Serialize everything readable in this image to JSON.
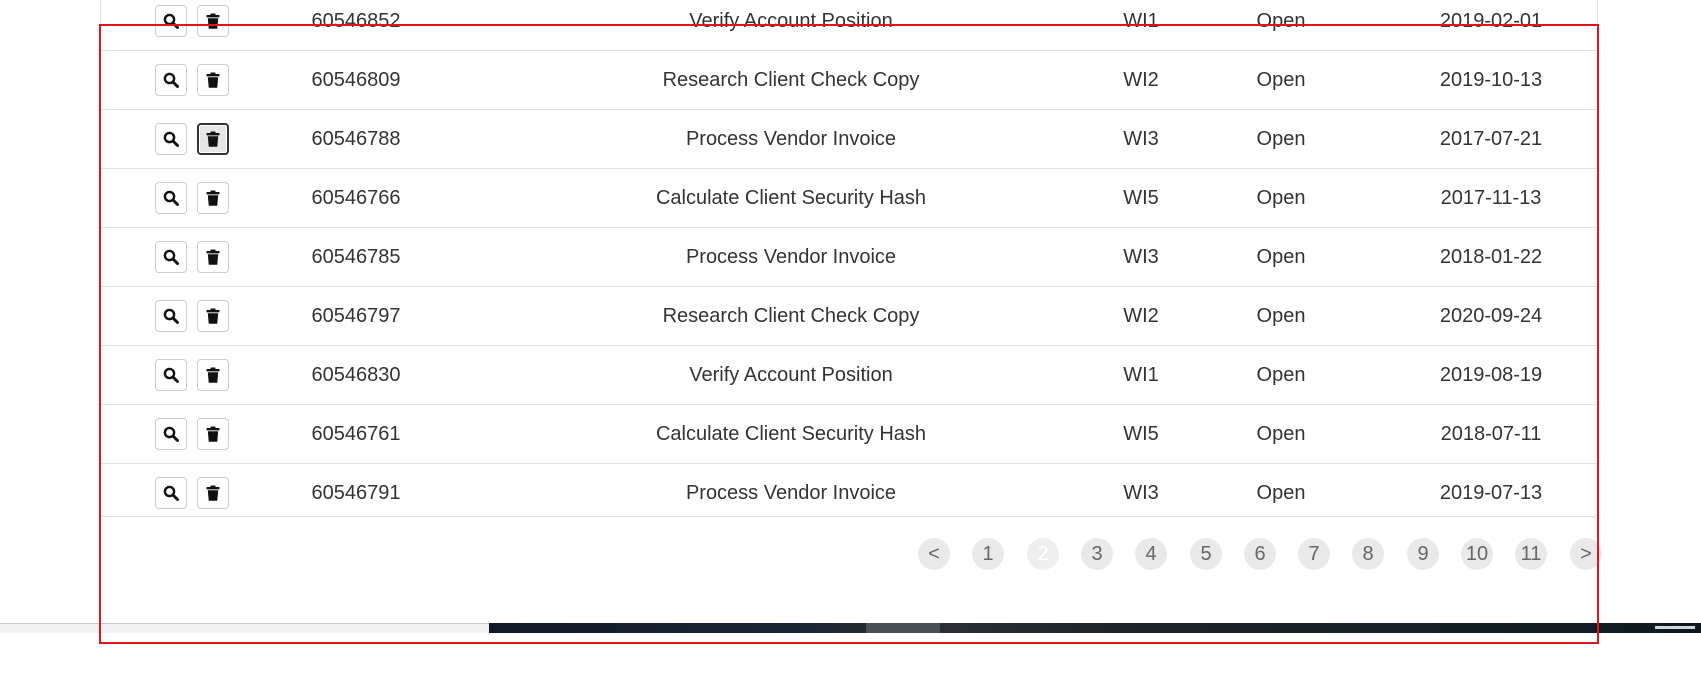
{
  "rows": [
    {
      "id": "60546852",
      "description": "Verify Account Position",
      "code": "WI1",
      "status": "Open",
      "date": "2019-02-01"
    },
    {
      "id": "60546809",
      "description": "Research Client Check Copy",
      "code": "WI2",
      "status": "Open",
      "date": "2019-10-13"
    },
    {
      "id": "60546788",
      "description": "Process Vendor Invoice",
      "code": "WI3",
      "status": "Open",
      "date": "2017-07-21"
    },
    {
      "id": "60546766",
      "description": "Calculate Client Security Hash",
      "code": "WI5",
      "status": "Open",
      "date": "2017-11-13"
    },
    {
      "id": "60546785",
      "description": "Process Vendor Invoice",
      "code": "WI3",
      "status": "Open",
      "date": "2018-01-22"
    },
    {
      "id": "60546797",
      "description": "Research Client Check Copy",
      "code": "WI2",
      "status": "Open",
      "date": "2020-09-24"
    },
    {
      "id": "60546830",
      "description": "Verify Account Position",
      "code": "WI1",
      "status": "Open",
      "date": "2019-08-19"
    },
    {
      "id": "60546761",
      "description": "Calculate Client Security Hash",
      "code": "WI5",
      "status": "Open",
      "date": "2018-07-11"
    },
    {
      "id": "60546791",
      "description": "Process Vendor Invoice",
      "code": "WI3",
      "status": "Open",
      "date": "2019-07-13"
    }
  ],
  "row_actions": {
    "view_icon": "search-icon",
    "delete_icon": "trash-icon",
    "focused_delete_row": 3
  },
  "pagination": {
    "prev_label": "<",
    "next_label": ">",
    "pages": [
      "1",
      "2",
      "3",
      "4",
      "5",
      "6",
      "7",
      "8",
      "9",
      "10",
      "11"
    ],
    "current_page": "2"
  },
  "colors": {
    "highlight_frame": "#e0141e",
    "page_button_bg": "#e9e9e9",
    "text": "#333333"
  }
}
